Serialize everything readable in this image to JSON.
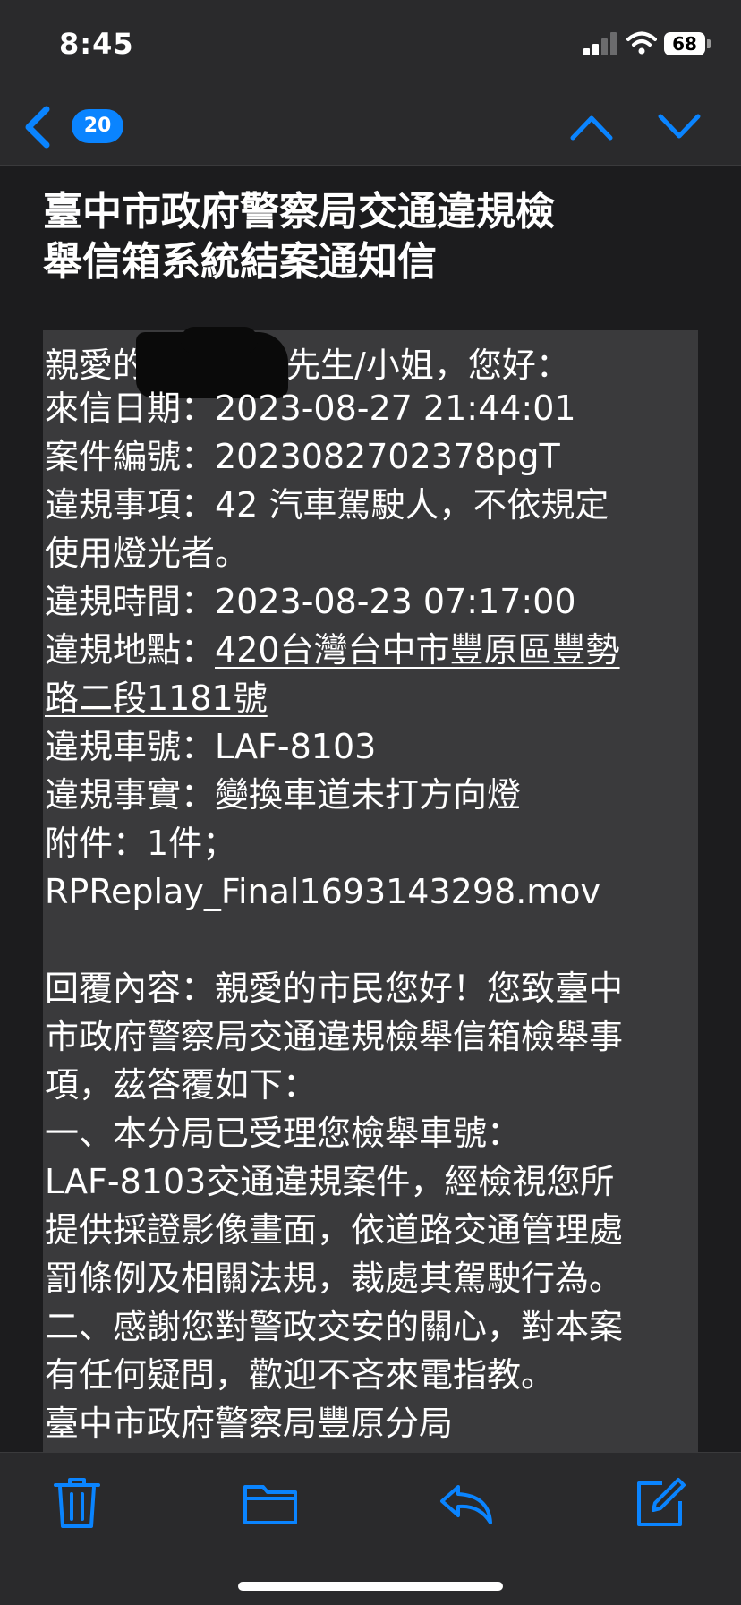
{
  "status_bar": {
    "time": "8:45",
    "battery": "68"
  },
  "nav": {
    "unread_count": "20",
    "icons": [
      "back-chevron-icon",
      "previous-message-icon",
      "next-message-icon"
    ]
  },
  "email": {
    "subject": [
      "臺中市政府警察局交通違規檢",
      "舉信箱系統結案通知信"
    ],
    "greeting": {
      "prefix": "親愛的",
      "suffix": "先生/小姐，您好："
    },
    "lines": [
      "來信日期：2023-08-27 21:44:01",
      "案件編號：2023082702378pgT",
      "違規事項：42 汽車駕駛人，不依規定",
      "使用燈光者。",
      "違規時間：2023-08-23 07:17:00"
    ],
    "location": {
      "label": "違規地點：",
      "address_line1": "420台灣台中市豐原區豐勢",
      "address_line2": "路二段1181號"
    },
    "lines2": [
      "違規車號：LAF-8103",
      "違規事實：變換車道未打方向燈",
      "附件：1件；",
      "RPReplay_Final1693143298.mov"
    ],
    "reply": [
      "回覆內容：親愛的市民您好！您致臺中",
      "市政府警察局交通違規檢舉信箱檢舉事",
      "項，茲答覆如下：",
      "一、本分局已受理您檢舉車號：",
      "LAF-8103交通違規案件，經檢視您所",
      "提供採證影像畫面，依道路交通管理處",
      "罰條例及相關法規，裁處其駕駛行為。",
      "二、感謝您對警政交安的關心，對本案",
      "有任何疑問，歡迎不吝來電指教。",
      "臺中市政府警察局豐原分局"
    ]
  },
  "toolbar": {
    "icons": [
      "trash-icon",
      "folder-icon",
      "reply-icon",
      "compose-icon"
    ]
  },
  "colors": {
    "accent": "#0a84ff",
    "background": "#1c1c1e",
    "bars": "#2a2a2c",
    "body_box": "#3a3a3c"
  }
}
